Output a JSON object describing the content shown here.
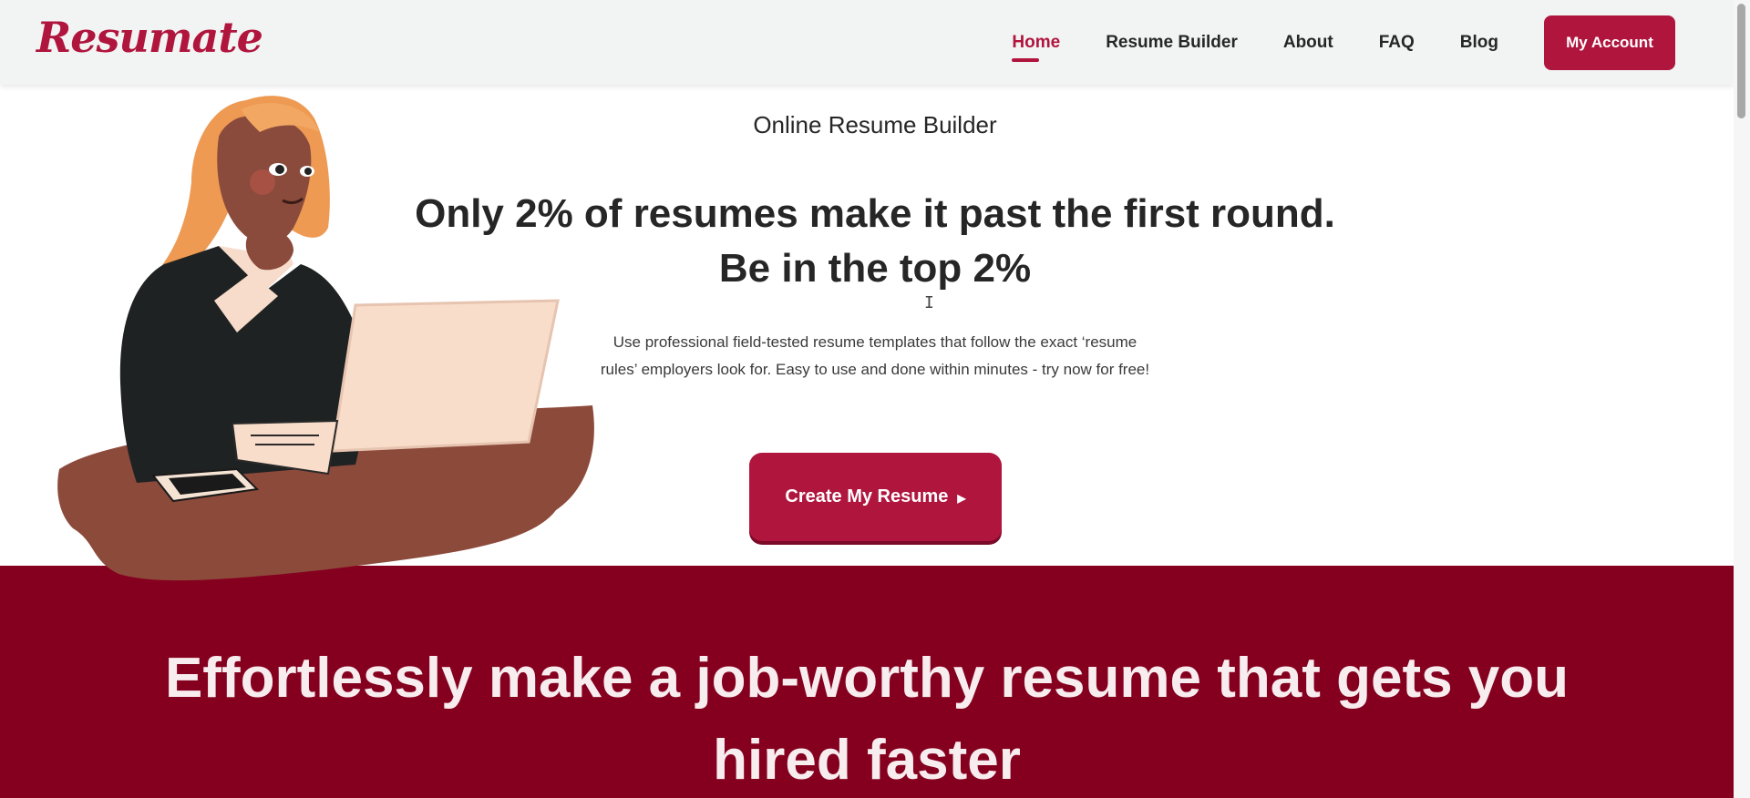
{
  "header": {
    "logo_text": "Resumate",
    "nav": [
      {
        "label": "Home",
        "active": true
      },
      {
        "label": "Resume Builder",
        "active": false
      },
      {
        "label": "About",
        "active": false
      },
      {
        "label": "FAQ",
        "active": false
      },
      {
        "label": "Blog",
        "active": false
      }
    ],
    "account_button": "My Account"
  },
  "hero": {
    "eyebrow": "Online Resume Builder",
    "headline_line1": "Only 2% of resumes make it past the first round.",
    "headline_line2": "Be in the top 2%",
    "subtext": "Use professional field-tested resume templates that follow the exact ‘resume rules’ employers look for. Easy to use and done within minutes - try now for free!",
    "cta_label": "Create My Resume",
    "cta_icon": "triangle-right-icon",
    "illustration": "woman-at-laptop-illustration"
  },
  "band": {
    "title_line1": "Effortlessly make a job-worthy resume that gets you",
    "title_line2": "hired faster"
  },
  "colors": {
    "brand": "#b0153d",
    "band": "#85001f",
    "header_bg": "#f2f3f3"
  }
}
